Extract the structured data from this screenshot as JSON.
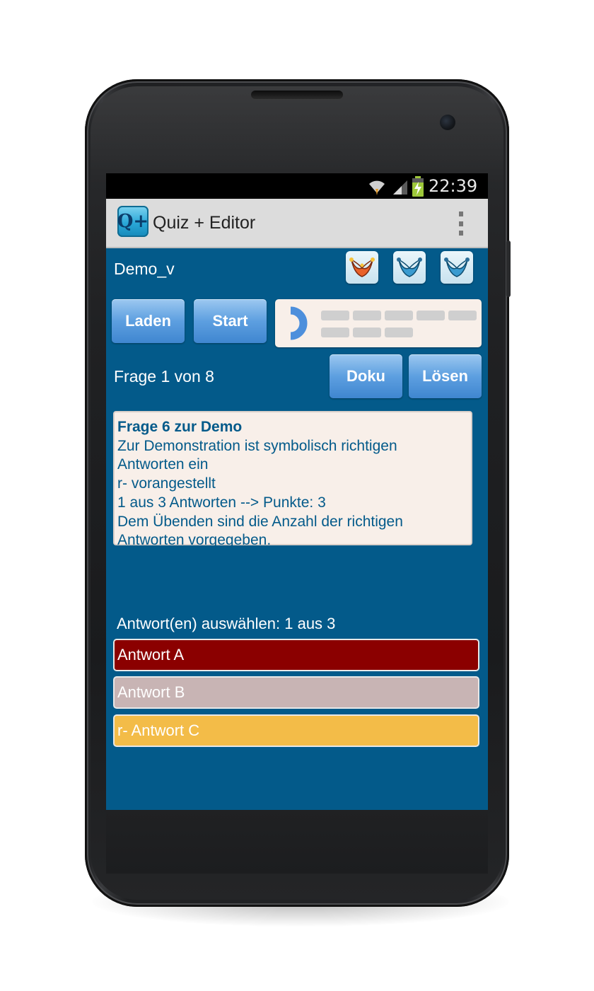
{
  "status_bar": {
    "time": "22:39"
  },
  "app_bar": {
    "icon_text": "Q+",
    "title": "Quiz + Editor"
  },
  "quiz": {
    "file_name": "Demo_v",
    "load_label": "Laden",
    "start_label": "Start",
    "doku_label": "Doku",
    "solve_label": "Lösen",
    "counter": "Frage  1 von 8",
    "question": {
      "title": "Frage 6 zur Demo",
      "lines": [
        "Zur Demonstration ist symbolisch richtigen",
        "Antworten ein",
        "r- vorangestellt",
        "1 aus 3 Antworten --> Punkte: 3",
        "Dem Übenden sind die Anzahl der richtigen",
        "Antworten vorgegeben."
      ]
    },
    "answer_prompt": "Antwort(en) auswählen:  1 aus 3",
    "answers": [
      {
        "label": "Antwort A",
        "color": "#8b0000"
      },
      {
        "label": "Antwort B",
        "color": "#c8b4b4"
      },
      {
        "label": "r- Antwort C",
        "color": "#f3bc48"
      }
    ],
    "jokers": [
      {
        "name": "joker-hat-icon",
        "color": "#e8612a",
        "active": true
      },
      {
        "name": "joker-hat-icon",
        "color": "#3a9bd0",
        "active": false
      },
      {
        "name": "joker-hat-icon",
        "color": "#3a9bd0",
        "active": false
      }
    ],
    "progress_fraction": 0.125
  },
  "colors": {
    "background": "#035a8a",
    "button": "#5d9fe0",
    "panel": "#f8efe9"
  }
}
